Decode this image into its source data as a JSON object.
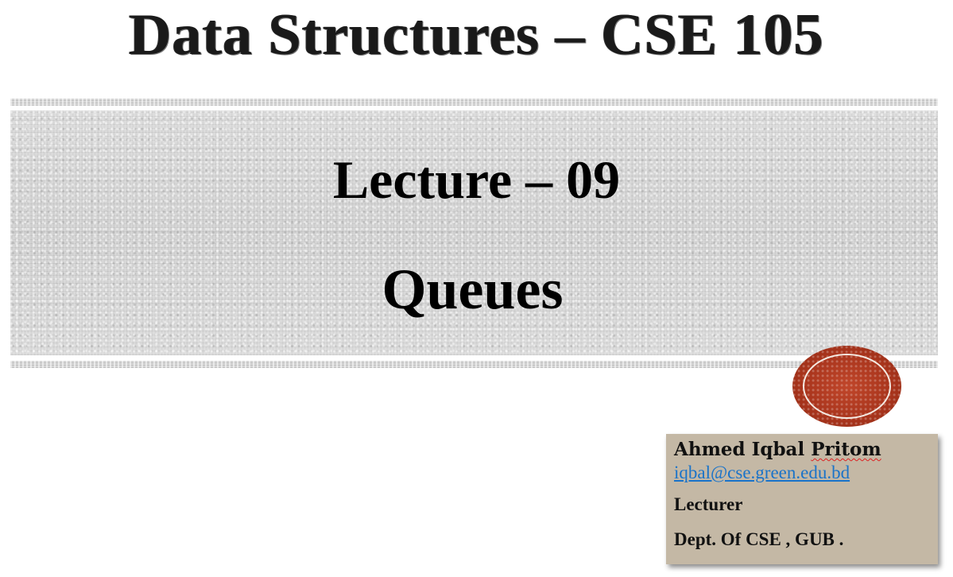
{
  "slide": {
    "course_title": "Data Structures – CSE 105",
    "lecture_number": "Lecture – 09",
    "lecture_topic": "Queues"
  },
  "author": {
    "name_first": "Ahmed Iqbal",
    "name_last": "Pritom",
    "email": "iqbal@cse.green.edu.bd",
    "role": "Lecturer",
    "department": "Dept. Of CSE , GUB ."
  },
  "colors": {
    "seal": "#a8341c",
    "info_box": "#c4b8a5",
    "link": "#1a73c9"
  }
}
